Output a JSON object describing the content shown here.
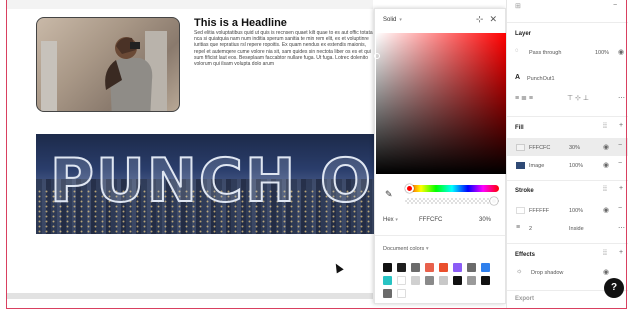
{
  "canvas": {
    "headline": "This is a Headline",
    "body": "Sed elitia voluptatibus quid ut quis is recnsen quaet kilt quae to es aut offic totata nca si quiatquia nam num inditia sperum sanitia te min rem elit, ex et voluptinre iuritias que repratius rsl repere ropoitis. Ex quam nendus ex estendis maionis, repel et autemqere cume volore nia sit, sam quides sin nectota liber os es et qui sum fificist laut eos. Beseplaam faccabtor nullare fuga. Ut fuga. Lotrec dolenito volorum qui ilsam volupta dolo arum",
    "banner_text": "PUNCH OUT"
  },
  "picker": {
    "mode": "Solid",
    "format": "Hex",
    "hex": "FFFCFC",
    "opacity": "30%",
    "doc_colors_label": "Document colors",
    "swatches": [
      "#111111",
      "#1f1f1f",
      "#6b6b6b",
      "#e8614c",
      "#ea4f2d",
      "#8b5cf6",
      "#6b6b6b",
      "#2f80ed",
      "#28c3c3",
      "#ffffff",
      "#d0d0d0",
      "#8a8a8a",
      "#c8c8c8",
      "#111111",
      "#9a9a9a",
      "#111111",
      "#6b6b6b",
      "#ffffff"
    ]
  },
  "panel": {
    "layer_title": "Layer",
    "blend_mode": "Pass through",
    "layer_opacity": "100%",
    "layer_name": "PunchOut1",
    "fill_title": "Fill",
    "fill_hex": "FFFCFC",
    "fill_opacity": "30%",
    "image_label": "Image",
    "image_opacity": "100%",
    "stroke_title": "Stroke",
    "stroke_hex": "FFFFFF",
    "stroke_opacity": "100%",
    "stroke_weight": "2",
    "stroke_position": "Inside",
    "effects_title": "Effects",
    "effect_name": "Drop shadow",
    "export_title": "Export",
    "colors": {
      "fill_swatch": "#f3f3f3",
      "image_swatch": "#2f4a75",
      "stroke_swatch": "#ffffff"
    }
  },
  "help_label": "?"
}
